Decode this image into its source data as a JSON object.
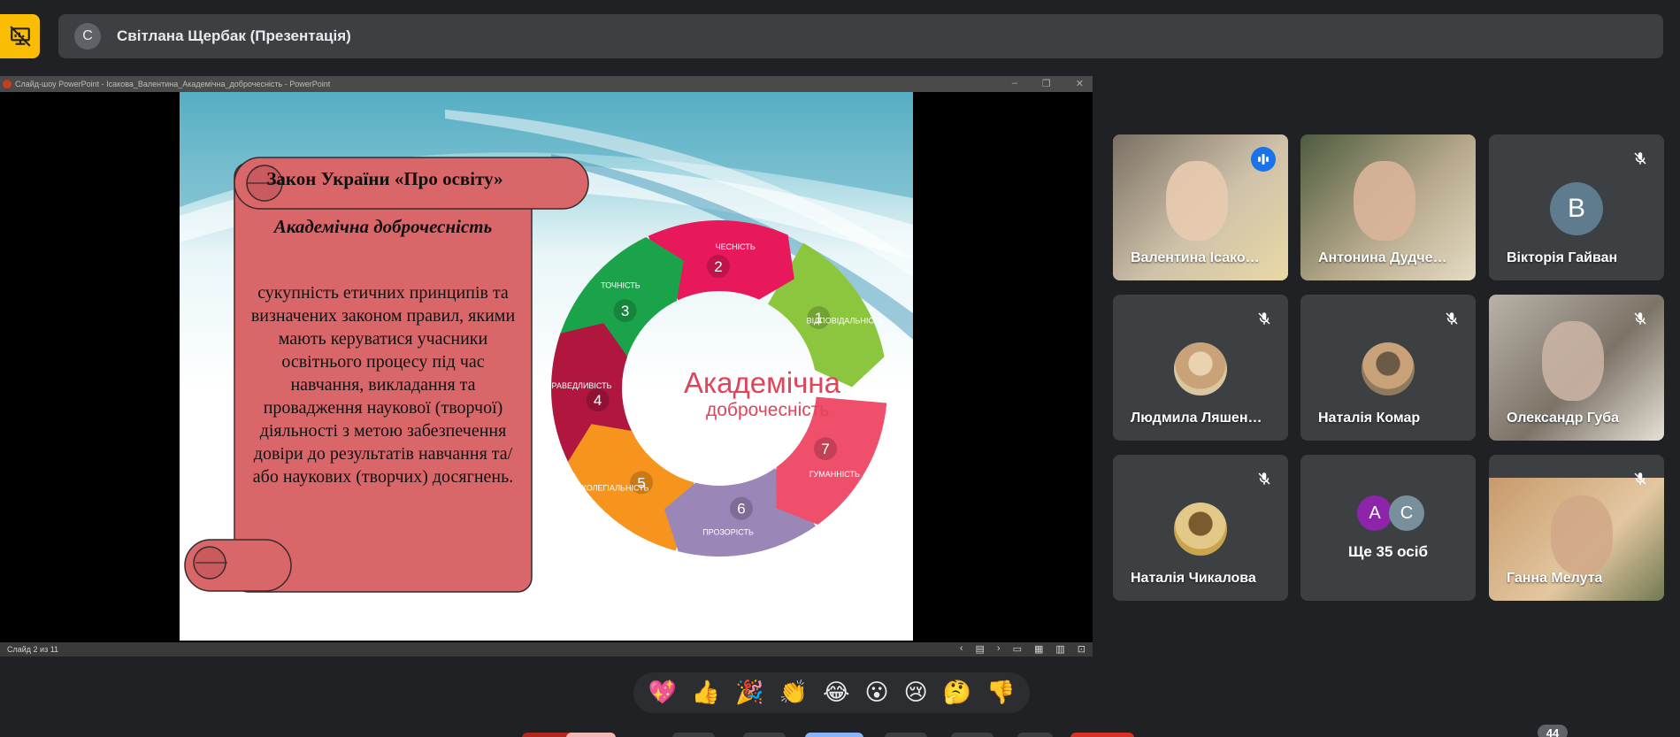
{
  "presenter": {
    "avatar_letter": "С",
    "name": "Світлана Щербак (Презентація)"
  },
  "ppt": {
    "titlebar": "Слайд-шоу PowerPoint  -  Ісакова_Валентина_Академічна_доброчесність - PowerPoint",
    "status": "Слайд 2 из 11"
  },
  "slide": {
    "title": "Закон України «Про освіту»",
    "subtitle": "Академічна доброчесність",
    "definition": "сукупність етичних принципів та визначених законом правил, якими мають керуватися учасники освітнього процесу під час навчання, викладання та провадження наукової (творчої) діяльності з метою забезпечення довіри до результатів навчання та/або наукових (творчих) досягнень.",
    "cycle_title": "Академічна",
    "cycle_subtitle": "доброчесність",
    "cycle_items": [
      {
        "num": "1",
        "label": "ВІДПОВІДАЛЬНІСТЬ",
        "color": "#8cc63f"
      },
      {
        "num": "2",
        "label": "ЧЕСНІСТЬ",
        "color": "#e8195a"
      },
      {
        "num": "3",
        "label": "ТОЧНІСТЬ",
        "color": "#1aa34a"
      },
      {
        "num": "4",
        "label": "СПРАВЕДЛИВІСТЬ",
        "color": "#b0163e"
      },
      {
        "num": "5",
        "label": "КОЛЕГІАЛЬНІСТЬ",
        "color": "#f7941d"
      },
      {
        "num": "6",
        "label": "ПРОЗОРІСТЬ",
        "color": "#9b86b8"
      },
      {
        "num": "7",
        "label": "ГУМАННІСТЬ",
        "color": "#ef4f6a"
      }
    ]
  },
  "reactions": [
    "💖",
    "👍",
    "🎉",
    "👏",
    "😂",
    "😮",
    "😢",
    "🤔",
    "👎"
  ],
  "participants": [
    {
      "name": "Валентина Ісако…",
      "state": "speaking"
    },
    {
      "name": "Антонина Дудче…",
      "state": "video"
    },
    {
      "name": "Вікторія Гайван",
      "state": "muted",
      "avatar_letter": "В"
    },
    {
      "name": "Людмила Ляшен…",
      "state": "muted"
    },
    {
      "name": "Наталія Комар",
      "state": "muted"
    },
    {
      "name": "Олександр Губа",
      "state": "muted"
    },
    {
      "name": "Наталія Чикалова",
      "state": "muted"
    },
    {
      "name": "Ще 35 осіб",
      "state": "more",
      "letters": [
        "А",
        "С"
      ]
    },
    {
      "name": "Ганна Мелута",
      "state": "muted"
    }
  ],
  "participant_count": "44",
  "colors": {
    "accent": "#8ab4f8",
    "present_button": "#fbbc04",
    "scroll_fill": "#d9676a",
    "tile_bg": "#3c4043"
  }
}
